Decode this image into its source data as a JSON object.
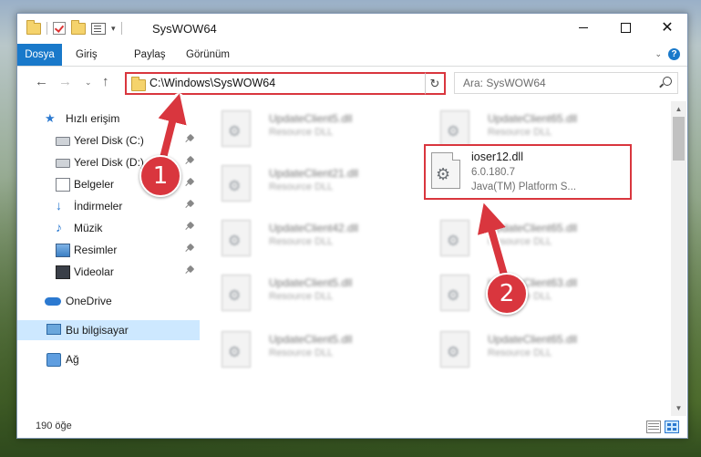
{
  "window": {
    "title": "SysWOW64",
    "qat_dropdown": "▾",
    "minimize_label": "",
    "maximize_label": "",
    "close_label": "✕"
  },
  "ribbon": {
    "tabs": [
      "Dosya",
      "Giriş",
      "Paylaş",
      "Görünüm"
    ],
    "collapse": "⌄",
    "help": "?"
  },
  "nav": {
    "back": "←",
    "forward": "→",
    "recent": "⌄",
    "up": "↑",
    "address": "C:\\Windows\\SysWOW64",
    "address_dropdown": "⌄",
    "refresh": "↻",
    "search_placeholder": "Ara: SysWOW64"
  },
  "sidebar": {
    "items": [
      {
        "label": "Hızlı erişim",
        "icon": "star-icon"
      },
      {
        "label": "Yerel Disk (C:)",
        "icon": "disk-icon",
        "pinned": true
      },
      {
        "label": "Yerel Disk (D:)",
        "icon": "disk-icon",
        "pinned": true
      },
      {
        "label": "Belgeler",
        "icon": "documents-icon",
        "pinned": true
      },
      {
        "label": "İndirmeler",
        "icon": "downloads-icon",
        "pinned": true
      },
      {
        "label": "Müzik",
        "icon": "music-icon",
        "pinned": true
      },
      {
        "label": "Resimler",
        "icon": "pictures-icon",
        "pinned": true
      },
      {
        "label": "Videolar",
        "icon": "videos-icon",
        "pinned": true
      },
      {
        "label": "OneDrive",
        "icon": "onedrive-icon"
      },
      {
        "label": "Bu bilgisayar",
        "icon": "this-pc-icon",
        "selected": true
      },
      {
        "label": "Ağ",
        "icon": "network-icon"
      }
    ]
  },
  "files": [
    {
      "name": "UpdateClient5.dll",
      "desc": "Resource DLL"
    },
    {
      "name": "UpdateClient65.dll",
      "desc": "Resource DLL"
    },
    {
      "name": "UpdateClient21.dll",
      "desc": "Resource DLL"
    },
    {
      "name": "UpdateClient42.dll",
      "desc": "Resource DLL"
    },
    {
      "name": "UpdateClient65.dll",
      "desc": "Resource DLL"
    },
    {
      "name": "UpdateClient5.dll",
      "desc": "Resource DLL"
    },
    {
      "name": "UpdateClient63.dll",
      "desc": "Resource DLL"
    },
    {
      "name": "UpdateClient5.dll",
      "desc": "Resource DLL"
    },
    {
      "name": "UpdateClient65.dll",
      "desc": "Resource DLL"
    }
  ],
  "focused_file": {
    "name": "ioser12.dll",
    "version": "6.0.180.7",
    "description": "Java(TM) Platform S...",
    "icon_glyph": "⚙"
  },
  "scroll": {
    "up": "▲",
    "down": "▼"
  },
  "status": {
    "count": "190 öğe"
  },
  "annotations": {
    "step1": "1",
    "step2": "2",
    "color": "#d9363e"
  }
}
